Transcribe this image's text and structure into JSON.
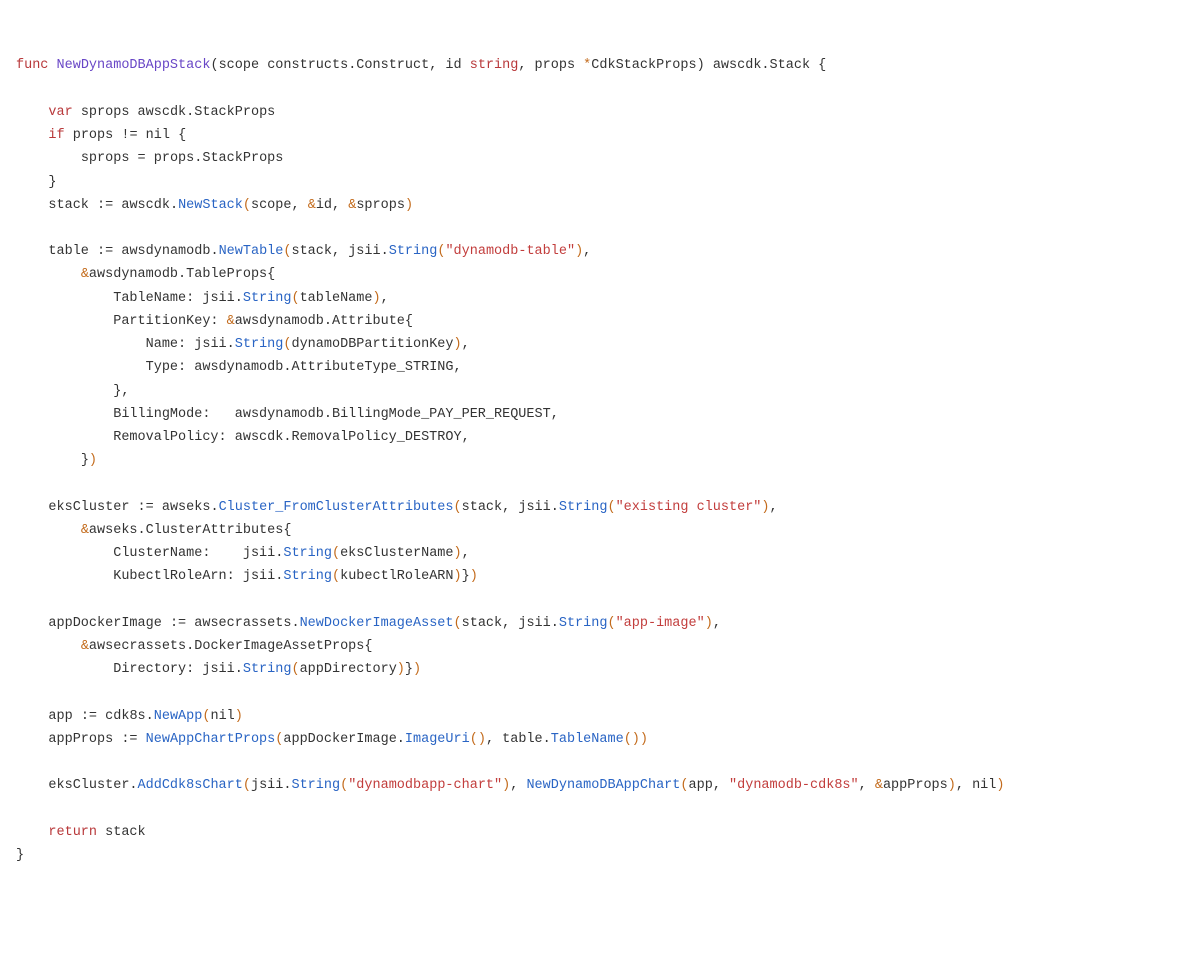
{
  "tokens": {
    "kw_func": "func",
    "fn_name": "NewDynamoDBAppStack",
    "p_open": "(",
    "p_close": ")",
    "scope": "scope",
    "constructs_Construct": "constructs.Construct",
    "id": "id",
    "kw_string": "string",
    "props": "props",
    "star": "*",
    "CdkStackProps": "CdkStackProps",
    "ret_awscdk_Stack": "awscdk.Stack",
    "brace_open": "{",
    "brace_close": "}",
    "kw_var": "var",
    "sprops": "sprops",
    "awscdk_StackProps": "awscdk.StackProps",
    "kw_if": "if",
    "ne_nil": "!= nil",
    "assign": "=",
    "props_StackProps": "props.StackProps",
    "stack": "stack",
    "coloneq": ":=",
    "awscdk": "awscdk.",
    "NewStack": "NewStack",
    "amp": "&",
    "table": "table",
    "awsdynamodb": "awsdynamodb.",
    "NewTable": "NewTable",
    "jsii": "jsii.",
    "String": "String",
    "s_dynamodb_table": "\"dynamodb-table\"",
    "TableProps": "awsdynamodb.TableProps",
    "TableName": "TableName:",
    "tableName": "tableName",
    "PartitionKey": "PartitionKey:",
    "Attribute": "awsdynamodb.Attribute",
    "Name": "Name:",
    "dynamoDBPartitionKey": "dynamoDBPartitionKey",
    "Type": "Type:",
    "AttributeType_STRING": "awsdynamodb.AttributeType_STRING",
    "BillingMode": "BillingMode:",
    "BillingMode_PPR": "awsdynamodb.BillingMode_PAY_PER_REQUEST",
    "RemovalPolicy": "RemovalPolicy:",
    "RemovalPolicy_DESTROY": "awscdk.RemovalPolicy_DESTROY",
    "eksCluster": "eksCluster",
    "awseks": "awseks.",
    "Cluster_FromClusterAttributes": "Cluster_FromClusterAttributes",
    "s_existing_cluster": "\"existing cluster\"",
    "ClusterAttributes": "awseks.ClusterAttributes",
    "ClusterName": "ClusterName:",
    "eksClusterName": "eksClusterName",
    "KubectlRoleArn": "KubectlRoleArn:",
    "kubectlRoleARN": "kubectlRoleARN",
    "appDockerImage": "appDockerImage",
    "awsecrassets": "awsecrassets.",
    "NewDockerImageAsset": "NewDockerImageAsset",
    "s_app_image": "\"app-image\"",
    "DockerImageAssetProps": "awsecrassets.DockerImageAssetProps",
    "Directory": "Directory:",
    "appDirectory": "appDirectory",
    "app": "app",
    "cdk8s": "cdk8s.",
    "NewApp": "NewApp",
    "nil": "nil",
    "appProps": "appProps",
    "NewAppChartProps": "NewAppChartProps",
    "ImageUri": "ImageUri",
    "TableNameMeth": "TableName",
    "AddCdk8sChart": "AddCdk8sChart",
    "s_dynamodbapp_chart": "\"dynamodbapp-chart\"",
    "NewDynamoDBAppChart": "NewDynamoDBAppChart",
    "s_dynamodb_cdk8s": "\"dynamodb-cdk8s\"",
    "kw_return": "return"
  }
}
